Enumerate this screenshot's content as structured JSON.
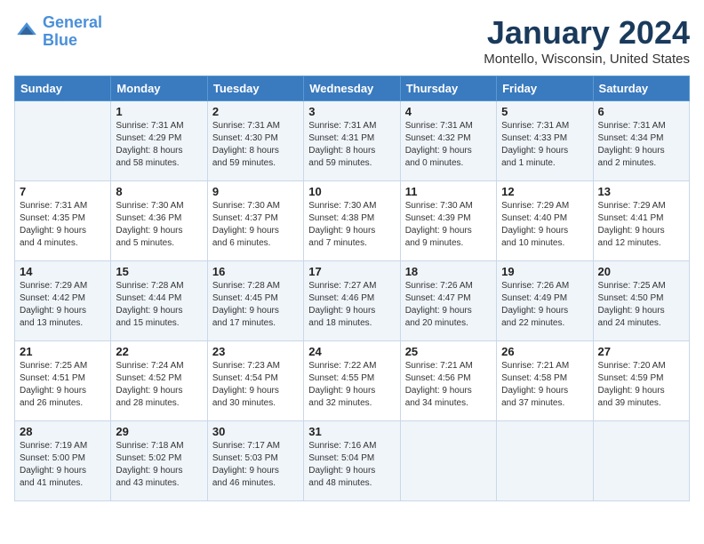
{
  "logo": {
    "line1": "General",
    "line2": "Blue"
  },
  "title": "January 2024",
  "location": "Montello, Wisconsin, United States",
  "days_of_week": [
    "Sunday",
    "Monday",
    "Tuesday",
    "Wednesday",
    "Thursday",
    "Friday",
    "Saturday"
  ],
  "weeks": [
    [
      {
        "day": "",
        "content": ""
      },
      {
        "day": "1",
        "content": "Sunrise: 7:31 AM\nSunset: 4:29 PM\nDaylight: 8 hours\nand 58 minutes."
      },
      {
        "day": "2",
        "content": "Sunrise: 7:31 AM\nSunset: 4:30 PM\nDaylight: 8 hours\nand 59 minutes."
      },
      {
        "day": "3",
        "content": "Sunrise: 7:31 AM\nSunset: 4:31 PM\nDaylight: 8 hours\nand 59 minutes."
      },
      {
        "day": "4",
        "content": "Sunrise: 7:31 AM\nSunset: 4:32 PM\nDaylight: 9 hours\nand 0 minutes."
      },
      {
        "day": "5",
        "content": "Sunrise: 7:31 AM\nSunset: 4:33 PM\nDaylight: 9 hours\nand 1 minute."
      },
      {
        "day": "6",
        "content": "Sunrise: 7:31 AM\nSunset: 4:34 PM\nDaylight: 9 hours\nand 2 minutes."
      }
    ],
    [
      {
        "day": "7",
        "content": "Sunrise: 7:31 AM\nSunset: 4:35 PM\nDaylight: 9 hours\nand 4 minutes."
      },
      {
        "day": "8",
        "content": "Sunrise: 7:30 AM\nSunset: 4:36 PM\nDaylight: 9 hours\nand 5 minutes."
      },
      {
        "day": "9",
        "content": "Sunrise: 7:30 AM\nSunset: 4:37 PM\nDaylight: 9 hours\nand 6 minutes."
      },
      {
        "day": "10",
        "content": "Sunrise: 7:30 AM\nSunset: 4:38 PM\nDaylight: 9 hours\nand 7 minutes."
      },
      {
        "day": "11",
        "content": "Sunrise: 7:30 AM\nSunset: 4:39 PM\nDaylight: 9 hours\nand 9 minutes."
      },
      {
        "day": "12",
        "content": "Sunrise: 7:29 AM\nSunset: 4:40 PM\nDaylight: 9 hours\nand 10 minutes."
      },
      {
        "day": "13",
        "content": "Sunrise: 7:29 AM\nSunset: 4:41 PM\nDaylight: 9 hours\nand 12 minutes."
      }
    ],
    [
      {
        "day": "14",
        "content": "Sunrise: 7:29 AM\nSunset: 4:42 PM\nDaylight: 9 hours\nand 13 minutes."
      },
      {
        "day": "15",
        "content": "Sunrise: 7:28 AM\nSunset: 4:44 PM\nDaylight: 9 hours\nand 15 minutes."
      },
      {
        "day": "16",
        "content": "Sunrise: 7:28 AM\nSunset: 4:45 PM\nDaylight: 9 hours\nand 17 minutes."
      },
      {
        "day": "17",
        "content": "Sunrise: 7:27 AM\nSunset: 4:46 PM\nDaylight: 9 hours\nand 18 minutes."
      },
      {
        "day": "18",
        "content": "Sunrise: 7:26 AM\nSunset: 4:47 PM\nDaylight: 9 hours\nand 20 minutes."
      },
      {
        "day": "19",
        "content": "Sunrise: 7:26 AM\nSunset: 4:49 PM\nDaylight: 9 hours\nand 22 minutes."
      },
      {
        "day": "20",
        "content": "Sunrise: 7:25 AM\nSunset: 4:50 PM\nDaylight: 9 hours\nand 24 minutes."
      }
    ],
    [
      {
        "day": "21",
        "content": "Sunrise: 7:25 AM\nSunset: 4:51 PM\nDaylight: 9 hours\nand 26 minutes."
      },
      {
        "day": "22",
        "content": "Sunrise: 7:24 AM\nSunset: 4:52 PM\nDaylight: 9 hours\nand 28 minutes."
      },
      {
        "day": "23",
        "content": "Sunrise: 7:23 AM\nSunset: 4:54 PM\nDaylight: 9 hours\nand 30 minutes."
      },
      {
        "day": "24",
        "content": "Sunrise: 7:22 AM\nSunset: 4:55 PM\nDaylight: 9 hours\nand 32 minutes."
      },
      {
        "day": "25",
        "content": "Sunrise: 7:21 AM\nSunset: 4:56 PM\nDaylight: 9 hours\nand 34 minutes."
      },
      {
        "day": "26",
        "content": "Sunrise: 7:21 AM\nSunset: 4:58 PM\nDaylight: 9 hours\nand 37 minutes."
      },
      {
        "day": "27",
        "content": "Sunrise: 7:20 AM\nSunset: 4:59 PM\nDaylight: 9 hours\nand 39 minutes."
      }
    ],
    [
      {
        "day": "28",
        "content": "Sunrise: 7:19 AM\nSunset: 5:00 PM\nDaylight: 9 hours\nand 41 minutes."
      },
      {
        "day": "29",
        "content": "Sunrise: 7:18 AM\nSunset: 5:02 PM\nDaylight: 9 hours\nand 43 minutes."
      },
      {
        "day": "30",
        "content": "Sunrise: 7:17 AM\nSunset: 5:03 PM\nDaylight: 9 hours\nand 46 minutes."
      },
      {
        "day": "31",
        "content": "Sunrise: 7:16 AM\nSunset: 5:04 PM\nDaylight: 9 hours\nand 48 minutes."
      },
      {
        "day": "",
        "content": ""
      },
      {
        "day": "",
        "content": ""
      },
      {
        "day": "",
        "content": ""
      }
    ]
  ]
}
